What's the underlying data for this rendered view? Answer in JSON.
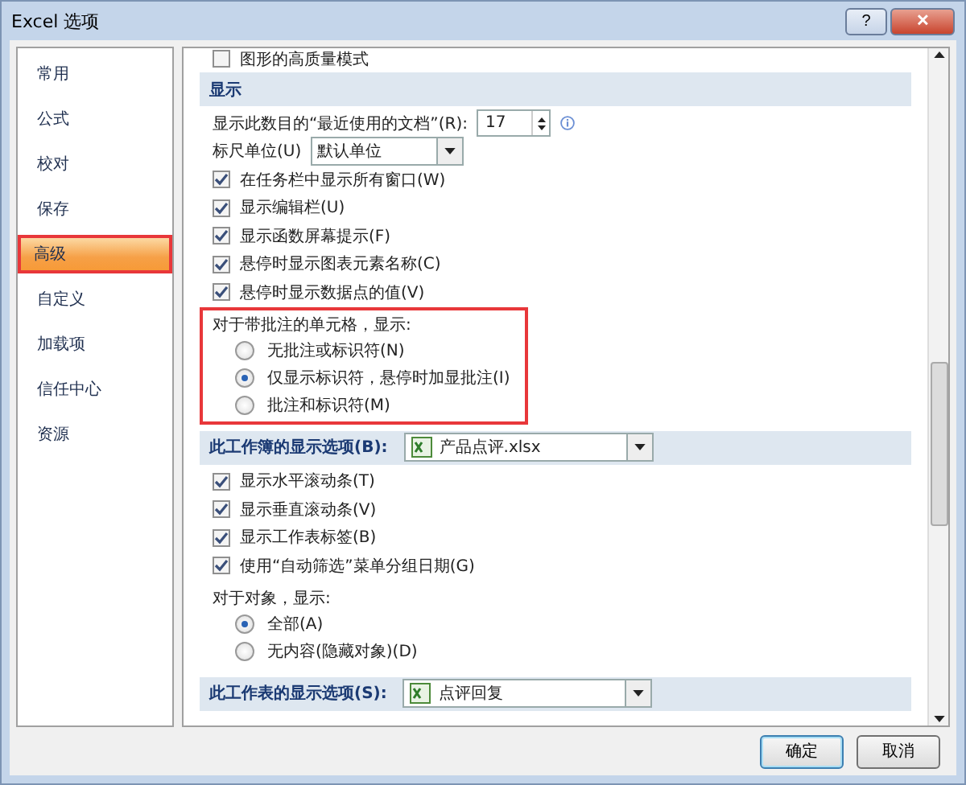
{
  "window": {
    "title": "Excel 选项",
    "buttons": [
      "?",
      "✕"
    ]
  },
  "sidebar": {
    "items": [
      {
        "label": "常用",
        "selected": false,
        "highlighted": false
      },
      {
        "label": "公式",
        "selected": false,
        "highlighted": false
      },
      {
        "label": "校对",
        "selected": false,
        "highlighted": false
      },
      {
        "label": "保存",
        "selected": false,
        "highlighted": false
      },
      {
        "label": "高级",
        "selected": true,
        "highlighted": true
      },
      {
        "label": "自定义",
        "selected": false,
        "highlighted": false
      },
      {
        "label": "加载项",
        "selected": false,
        "highlighted": false
      },
      {
        "label": "信任中心",
        "selected": false,
        "highlighted": false
      },
      {
        "label": "资源",
        "selected": false,
        "highlighted": false
      }
    ]
  },
  "content": [
    {
      "kind": "checkbox",
      "label": "图形的高质量模式",
      "checked": false
    },
    {
      "kind": "header",
      "label": "显示"
    },
    {
      "kind": "spinner",
      "label": "显示此数目的“最近使用的文档”(R):",
      "value": "17"
    },
    {
      "kind": "dropdown",
      "label": "标尺单位(U)",
      "value": "默认单位"
    },
    {
      "kind": "checkbox",
      "label": "在任务栏中显示所有窗口(W)",
      "checked": true
    },
    {
      "kind": "checkbox",
      "label": "显示编辑栏(U)",
      "checked": true
    },
    {
      "kind": "checkbox",
      "label": "显示函数屏幕提示(F)",
      "checked": true
    },
    {
      "kind": "checkbox",
      "label": "悬停时显示图表元素名称(C)",
      "checked": true
    },
    {
      "kind": "checkbox",
      "label": "悬停时显示数据点的值(V)",
      "checked": true
    },
    {
      "kind": "group",
      "label": "对于带批注的单元格，显示:",
      "highlighted": true,
      "options": [
        {
          "label": "无批注或标识符(N)",
          "selected": false
        },
        {
          "label": "仅显示标识符，悬停时加显批注(I)",
          "selected": true
        },
        {
          "label": "批注和标识符(M)",
          "selected": false
        }
      ]
    },
    {
      "kind": "header",
      "label": "此工作簿的显示选项(B):",
      "value": "产品点评.xlsx"
    },
    {
      "kind": "checkbox",
      "label": "显示水平滚动条(T)",
      "checked": true
    },
    {
      "kind": "checkbox",
      "label": "显示垂直滚动条(V)",
      "checked": true
    },
    {
      "kind": "checkbox",
      "label": "显示工作表标签(B)",
      "checked": true
    },
    {
      "kind": "checkbox",
      "label": "使用“自动筛选”菜单分组日期(G)",
      "checked": true
    },
    {
      "kind": "group",
      "label": "对于对象，显示:",
      "highlighted": false,
      "options": [
        {
          "label": "全部(A)",
          "selected": true
        },
        {
          "label": "无内容(隐藏对象)(D)",
          "selected": false
        }
      ]
    },
    {
      "kind": "header",
      "label": "此工作表的显示选项(S):",
      "value": "点评回复"
    }
  ],
  "footer": {
    "buttons": [
      "确定",
      "取消"
    ]
  }
}
